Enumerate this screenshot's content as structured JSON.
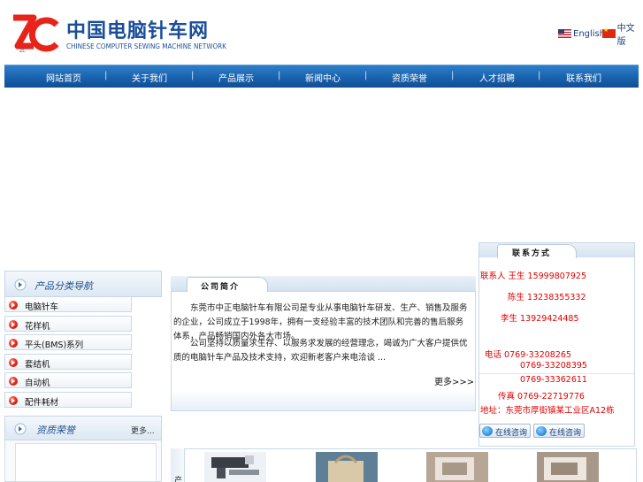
{
  "header": {
    "logo_mark": "ZC",
    "logo_cn": "中国电脑针车网",
    "logo_en": "CHINESE COMPUTER SEWING MACHINE NETWORK",
    "lang_en": "English",
    "lang_cn": "中文版"
  },
  "colors": {
    "brand_blue": "#1a4e9a",
    "nav_blue": "#1a62ad",
    "contact_red": "#e00000",
    "logo_red": "#e8231a"
  },
  "nav": {
    "items": [
      "网站首页",
      "关于我们",
      "产品展示",
      "新闻中心",
      "资质荣誉",
      "人才招聘",
      "联系我们"
    ],
    "separator": "|"
  },
  "sidebar": {
    "category_title": "产品分类导航",
    "categories": [
      "电脑针车",
      "花样机",
      "平头(BMS)系列",
      "套结机",
      "自动机",
      "配件耗材"
    ],
    "honor_title": "资质荣誉",
    "honor_more": "更多..."
  },
  "intro": {
    "tab_label": "公司简介",
    "p1": "东莞市中正电脑针车有限公司是专业从事电脑针车研发、生产、销售及服务的企业，公司成立于1998年，拥有一支经验丰富的技术团队和完善的售后服务体系，产品畅销国内外各大市场。",
    "p2": "公司坚持以质量求生存、以服务求发展的经营理念，竭诚为广大客户提供优质的电脑针车产品及技术支持，欢迎新老客户来电洽谈 ...",
    "more": "更多>>>"
  },
  "contact": {
    "tab_label": "联系方式",
    "lines": [
      "联系人 王生  15999807925",
      "陈生  13238355332",
      "李生  13929424485",
      "电话  0769-33208265",
      "0769-33208395",
      "0769-33362611",
      "传真 0769-22719776",
      "地址：东莞市厚街镇某工业区A12栋"
    ],
    "consult_label": "在线咨询"
  },
  "products": {
    "side_label": "产"
  }
}
